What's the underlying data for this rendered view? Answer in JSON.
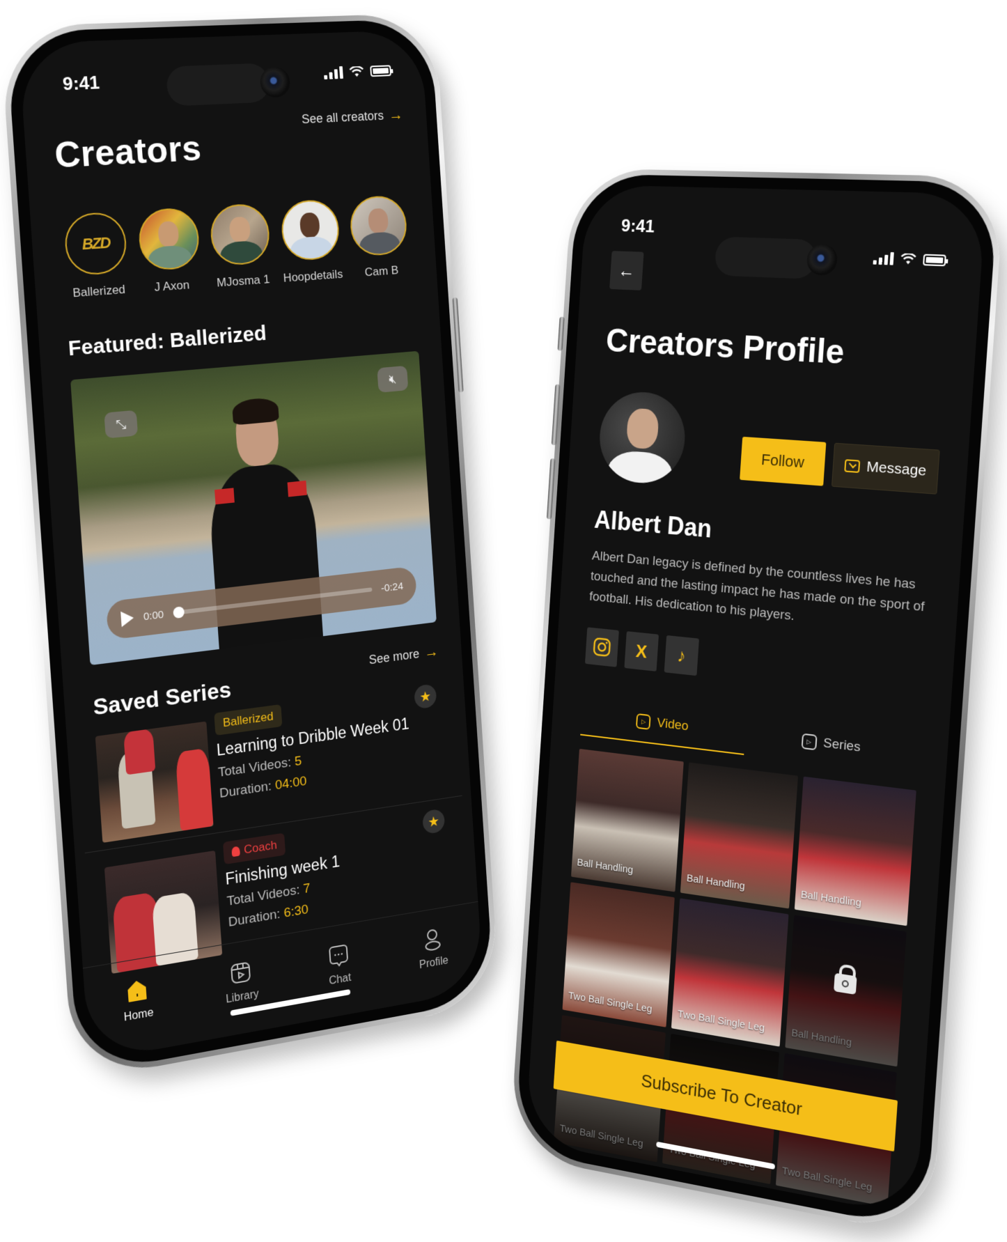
{
  "theme": {
    "accent": "#f5be18",
    "background": "#121212",
    "coach_red": "#ef4040"
  },
  "left_phone": {
    "status_bar": {
      "time": "9:41",
      "icons": [
        "signal-icon",
        "wifi-icon",
        "battery-icon"
      ]
    },
    "creators": {
      "title": "Creators",
      "see_all_label": "See all creators",
      "items": [
        {
          "name": "Ballerized",
          "avatar": "BZD"
        },
        {
          "name": "J Axon"
        },
        {
          "name": "MJosma 1"
        },
        {
          "name": "Hoopdetails"
        },
        {
          "name": "Cam B"
        }
      ]
    },
    "featured": {
      "title": "Featured: Ballerized",
      "player": {
        "elapsed": "0:00",
        "remaining": "-0:24",
        "progress": 0
      }
    },
    "saved_series": {
      "title": "Saved Series",
      "see_more_label": "See more",
      "total_videos_label": "Total Videos:",
      "duration_label": "Duration:",
      "items": [
        {
          "tag": "Ballerized",
          "tag_type": "brand",
          "title": "Learning to Dribble Week 01",
          "total_videos": "5",
          "duration": "04:00",
          "starred": true
        },
        {
          "tag": "Coach",
          "tag_type": "coach",
          "title": "Finishing week 1",
          "total_videos": "7",
          "duration": "6:30",
          "starred": true
        }
      ]
    },
    "nav": [
      {
        "label": "Home",
        "icon": "home-icon",
        "active": true
      },
      {
        "label": "Library",
        "icon": "library-icon",
        "active": false
      },
      {
        "label": "Chat",
        "icon": "chat-icon",
        "active": false
      },
      {
        "label": "Profile",
        "icon": "profile-icon",
        "active": false
      }
    ]
  },
  "right_phone": {
    "status_bar": {
      "time": "9:41",
      "icons": [
        "signal-icon",
        "wifi-icon",
        "battery-icon"
      ]
    },
    "title": "Creators Profile",
    "follow_label": "Follow",
    "message_label": "Message",
    "name": "Albert Dan",
    "bio": "Albert Dan legacy is defined by the countless lives he has touched and the lasting impact he has made on the sport of football. His dedication to his players.",
    "socials": [
      {
        "name": "instagram",
        "glyph": "◎"
      },
      {
        "name": "x",
        "glyph": "X"
      },
      {
        "name": "tiktok",
        "glyph": "♪"
      }
    ],
    "tabs": [
      {
        "label": "Video",
        "active": true
      },
      {
        "label": "Series",
        "active": false
      }
    ],
    "videos": [
      {
        "label": "Ball Handling",
        "locked": false
      },
      {
        "label": "Ball Handling",
        "locked": false
      },
      {
        "label": "Ball Handling",
        "locked": false
      },
      {
        "label": "Two Ball Single Leg",
        "locked": false
      },
      {
        "label": "Two Ball Single Leg",
        "locked": false
      },
      {
        "label": "Ball Handling",
        "locked": true
      },
      {
        "label": "Two Ball Single Leg",
        "locked": true
      },
      {
        "label": "Two Ball Single Leg",
        "locked": true
      },
      {
        "label": "Two Ball Single Leg",
        "locked": true
      }
    ],
    "subscribe_label": "Subscribe To Creator"
  }
}
